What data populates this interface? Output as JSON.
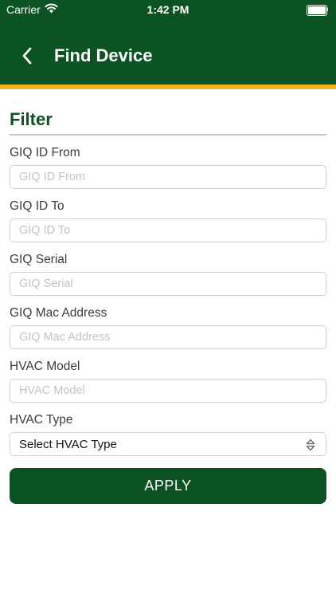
{
  "status_bar": {
    "carrier": "Carrier",
    "time": "1:42 PM"
  },
  "nav": {
    "title": "Find Device",
    "back_icon": "chevron-left-icon"
  },
  "filter": {
    "title": "Filter",
    "fields": [
      {
        "label": "GIQ ID From",
        "placeholder": "GIQ ID From",
        "value": ""
      },
      {
        "label": "GIQ ID To",
        "placeholder": "GIQ ID To",
        "value": ""
      },
      {
        "label": "GIQ Serial",
        "placeholder": "GIQ Serial",
        "value": ""
      },
      {
        "label": "GIQ Mac Address",
        "placeholder": "GIQ Mac Address",
        "value": ""
      },
      {
        "label": "HVAC Model",
        "placeholder": "HVAC Model",
        "value": ""
      }
    ],
    "hvac_type": {
      "label": "HVAC Type",
      "selected": "Select HVAC Type"
    }
  },
  "actions": {
    "apply_label": "APPLY"
  },
  "colors": {
    "brand_green": "#0b5322",
    "accent_gold": "#f0b323"
  }
}
